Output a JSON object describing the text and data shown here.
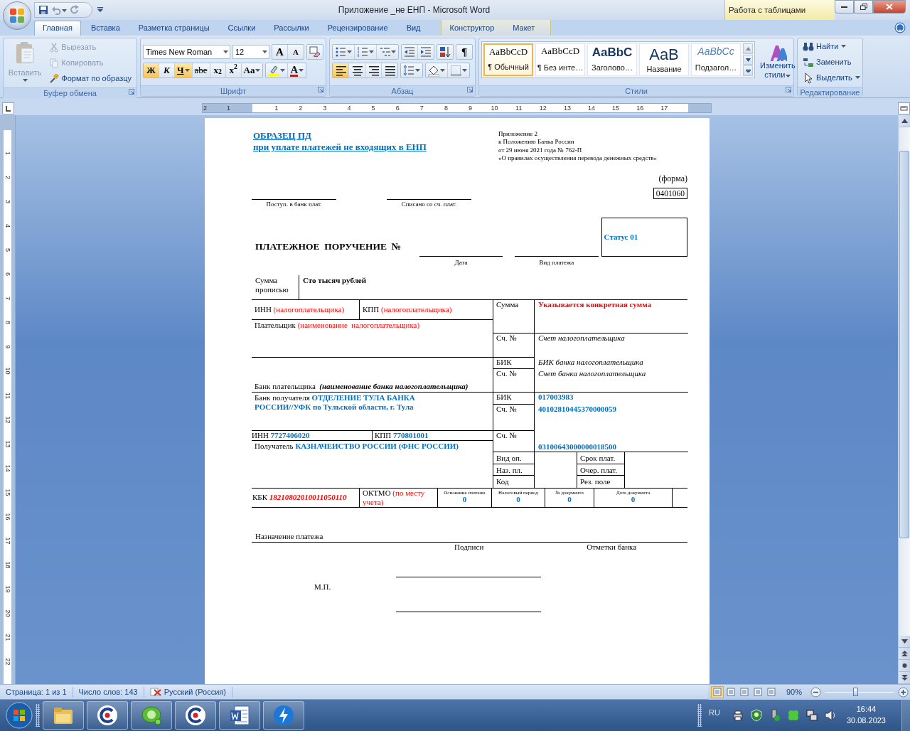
{
  "window": {
    "title": "Приложение _не ЕНП - Microsoft Word",
    "context_group": "Работа с таблицами"
  },
  "tabs": [
    {
      "label": "Главная",
      "selected": true,
      "kind": "main"
    },
    {
      "label": "Вставка",
      "selected": false,
      "kind": "main"
    },
    {
      "label": "Разметка страницы",
      "selected": false,
      "kind": "main"
    },
    {
      "label": "Ссылки",
      "selected": false,
      "kind": "main"
    },
    {
      "label": "Рассылки",
      "selected": false,
      "kind": "main"
    },
    {
      "label": "Рецензирование",
      "selected": false,
      "kind": "main"
    },
    {
      "label": "Вид",
      "selected": false,
      "kind": "main"
    },
    {
      "label": "Конструктор",
      "selected": false,
      "kind": "context"
    },
    {
      "label": "Макет",
      "selected": false,
      "kind": "context"
    }
  ],
  "ribbon": {
    "clipboard": {
      "title": "Буфер обмена",
      "paste": {
        "label": "Вставить",
        "disabled": true
      },
      "items": [
        {
          "label": "Вырезать",
          "disabled": true,
          "kind": "cut"
        },
        {
          "label": "Копировать",
          "disabled": true,
          "kind": "copy"
        },
        {
          "label": "Формат по образцу",
          "disabled": false,
          "kind": "painter"
        }
      ]
    },
    "font": {
      "title": "Шрифт",
      "font_name": "Times New Roman",
      "font_size": "12",
      "grow": "A",
      "shrink": "A",
      "font_color": "A",
      "buttons": [
        {
          "label": "Ж",
          "selected": true,
          "kind": "bold"
        },
        {
          "label": "К",
          "selected": false,
          "kind": "italic"
        },
        {
          "label": "Ч",
          "selected": true,
          "kind": "underline"
        },
        {
          "label": "abe",
          "selected": false,
          "kind": "strike"
        },
        {
          "label": "x$_{2}$",
          "selected": false,
          "kind": "plain"
        },
        {
          "label": "x$^{2}$",
          "selected": false,
          "kind": "plain"
        },
        {
          "label": "Aa",
          "selected": false,
          "kind": "case"
        }
      ]
    },
    "paragraph": {
      "title": "Абзац",
      "pilcrow": "¶",
      "alignment": [
        {
          "kind": "left",
          "selected": true
        },
        {
          "kind": "center",
          "selected": false
        },
        {
          "kind": "right",
          "selected": false
        },
        {
          "kind": "justify",
          "selected": false
        }
      ]
    },
    "styles": {
      "title": "Стили",
      "change": "Изменить стили",
      "items": [
        {
          "preview": "AaBbCcD",
          "label": "¶ Обычный",
          "selected": true,
          "kind": "normal"
        },
        {
          "preview": "AaBbCcD",
          "label": "¶ Без инте…",
          "selected": false,
          "kind": "normal"
        },
        {
          "preview": "AaBbC",
          "label": "Заголово…",
          "selected": false,
          "kind": "heading"
        },
        {
          "preview": "AaB",
          "label": "Название",
          "selected": false,
          "kind": "title"
        },
        {
          "preview": "AaBbCc",
          "label": "Подзагол…",
          "selected": false,
          "kind": "subtitle"
        }
      ]
    },
    "editing": {
      "title": "Редактирование",
      "items": [
        {
          "label": "Найти",
          "kind": "find"
        },
        {
          "label": "Заменить",
          "kind": "replace"
        },
        {
          "label": "Выделить",
          "kind": "select"
        }
      ]
    }
  },
  "ruler": {
    "horizontal": [
      "2",
      "1",
      "1",
      "2",
      "3",
      "4",
      "5",
      "6",
      "7",
      "8",
      "9",
      "10",
      "11",
      "12",
      "13",
      "14",
      "15",
      "16",
      "17"
    ],
    "vertical": [
      "1",
      "2",
      "3",
      "4",
      "5",
      "6",
      "7",
      "8",
      "9",
      "10",
      "11",
      "12",
      "13",
      "14",
      "15",
      "16",
      "17",
      "18",
      "19",
      "20",
      "21",
      "22"
    ]
  },
  "document": {
    "header": {
      "title_lines": [
        "ОБРАЗЕЦ ПД",
        "при уплате платежей не входящих  в ЕНП"
      ],
      "appendix_lines": [
        "Приложение 2",
        "к Положению Банка России",
        "от 29 июня 2021 года № 762-П",
        "«О правилах осуществления перевода денежных средств»"
      ]
    },
    "form_label": "(форма)",
    "form_code": "0401060",
    "receipt_fields": [
      "Поступ. в банк плат.",
      "Списано со сч. плат."
    ],
    "order_title": "ПЛАТЕЖНОЕ  ПОРУЧЕНИЕ  №",
    "date_label": "Дата",
    "payment_type_label": "Вид платежа",
    "status": "Статус 01",
    "amount_words": {
      "label": "Сумма прописью",
      "value": "Сто тысяч рублей"
    },
    "payer_inn": {
      "label": "ИНН",
      "value": "(налогоплательщика)",
      "kind": "hint"
    },
    "payer_kpp": {
      "label": "КПП",
      "value": "(налогоплательщика)",
      "kind": "hint"
    },
    "payer": {
      "label": "Плательщик",
      "value": "(наименование  налогоплательщика)",
      "kind": "hint"
    },
    "payer_bank": {
      "label": "Банк плательщика ",
      "value": "(наименование банка налогоплательщика)",
      "kind": "note"
    },
    "payee_bank": {
      "label": "Банк получателя ",
      "value": "ОТДЕЛЕНИЕ  ТУЛА БАНКА РОССИИ//УФК по Тульской области, г. Тула",
      "kind": "filled"
    },
    "payee_inn": {
      "label": "ИНН",
      "value": "7727406020",
      "kind": "filled"
    },
    "payee_kpp": {
      "label": "КПП",
      "value": "770801001",
      "kind": "filled"
    },
    "payee": {
      "label": "Получатель",
      "value": "КАЗНАЧЕИСТВО РОССИИ (ФНС РОССИИ)",
      "kind": "filled"
    },
    "accounts": [
      {
        "label": "Сумма",
        "value": "Указывается конкретная сумма",
        "kind": "hint_bold"
      },
      {
        "label": "Сч. №",
        "value": "Счет налогоплательщика",
        "kind": "italic"
      },
      {
        "label": "БИК",
        "value": "БИК банка налогоплательщика",
        "kind": "italic"
      },
      {
        "label": "Сч. №",
        "value": "Счет банка налогоплательщика",
        "kind": "italic"
      },
      {
        "label": "БИК",
        "value": "017003983",
        "kind": "filled"
      },
      {
        "label": "Сч. №",
        "value": "40102810445370000059",
        "kind": "filled"
      },
      {
        "label": "Сч. №",
        "value": "03100643000000018500",
        "kind": "filled"
      }
    ],
    "codes_left": [
      "Вид оп.",
      "Наз. пл.",
      "Код"
    ],
    "codes_right": [
      "Срок плат.",
      "Очер. плат.",
      "Рез. поле"
    ],
    "kbk": {
      "label": "КБК",
      "value": "18210802010011050110",
      "kind": "hint_italic"
    },
    "oktmo": {
      "label": "ОКТМО",
      "value": "(по месту учета)",
      "kind": "hint"
    },
    "tax_fields": [
      {
        "label": "Основание платежа",
        "value": "0"
      },
      {
        "label": "Налоговый период",
        "value": "0"
      },
      {
        "label": "№ документа",
        "value": "0"
      },
      {
        "label": "Дата документа",
        "value": "0"
      }
    ],
    "purpose_label": "Назначение платежа",
    "signatures_label": "Подписи",
    "bank_marks_label": "Отметки банка",
    "stamp_label": "М.П."
  },
  "status_bar": {
    "page": "Страница: 1 из 1",
    "words": "Число слов: 143",
    "language": "Русский (Россия)",
    "zoom": {
      "label": "90%",
      "level": 0.44
    }
  },
  "taskbar": {
    "apps": [
      {
        "kind": "folder"
      },
      {
        "kind": "c-app"
      },
      {
        "kind": "chat"
      },
      {
        "kind": "c-app"
      },
      {
        "kind": "word"
      },
      {
        "kind": "bolt"
      }
    ],
    "language": "RU",
    "time": "16:44",
    "date": "30.08.2023"
  }
}
